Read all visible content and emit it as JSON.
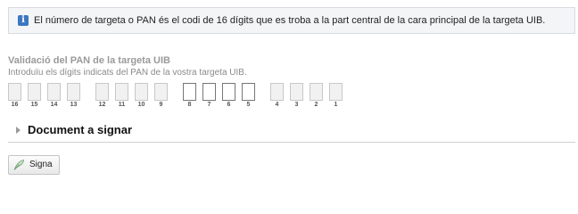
{
  "info": {
    "icon": "info-icon",
    "text": "El número de targeta o PAN és el codi de 16 dígits que es troba a la part central de la cara principal de la targeta UIB."
  },
  "pan": {
    "title": "Validació del PAN de la targeta UIB",
    "help": "Introduïu els dígits indicats del PAN de la vostra targeta UIB.",
    "digits": [
      {
        "label": "16",
        "active": false,
        "value": ""
      },
      {
        "label": "15",
        "active": false,
        "value": ""
      },
      {
        "label": "14",
        "active": false,
        "value": ""
      },
      {
        "label": "13",
        "active": false,
        "value": ""
      },
      {
        "label": "12",
        "active": false,
        "value": ""
      },
      {
        "label": "11",
        "active": false,
        "value": ""
      },
      {
        "label": "10",
        "active": false,
        "value": ""
      },
      {
        "label": "9",
        "active": false,
        "value": ""
      },
      {
        "label": "8",
        "active": true,
        "value": ""
      },
      {
        "label": "7",
        "active": true,
        "value": ""
      },
      {
        "label": "6",
        "active": true,
        "value": ""
      },
      {
        "label": "5",
        "active": true,
        "value": ""
      },
      {
        "label": "4",
        "active": false,
        "value": ""
      },
      {
        "label": "3",
        "active": false,
        "value": ""
      },
      {
        "label": "2",
        "active": false,
        "value": ""
      },
      {
        "label": "1",
        "active": false,
        "value": ""
      }
    ]
  },
  "document": {
    "label": "Document a signar",
    "icon": "triangle-right-icon"
  },
  "actions": {
    "sign_label": "Signa",
    "sign_icon": "quill-pen-icon"
  },
  "colors": {
    "info_icon": "#3b78c3",
    "info_background": "#f3f5f7"
  }
}
